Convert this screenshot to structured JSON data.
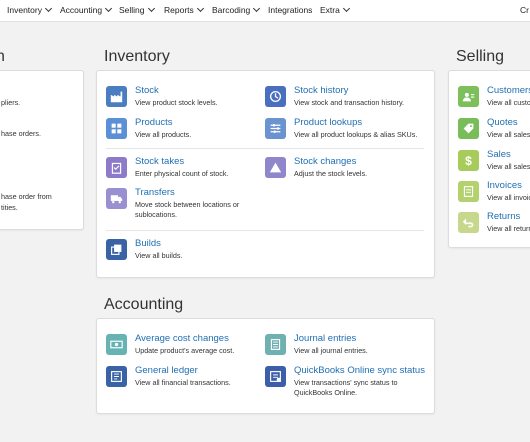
{
  "nav": {
    "items": [
      "Inventory",
      "Accounting",
      "Selling",
      "Reports",
      "Barcoding",
      "Integrations",
      "Extra"
    ],
    "right": "Cr"
  },
  "left_partial": {
    "title_frag": "n",
    "lines": [
      "pliers.",
      "hase orders.",
      "hase order from",
      "tities."
    ]
  },
  "inventory": {
    "title": "Inventory",
    "tiles": [
      {
        "title": "Stock",
        "desc": "View product stock levels.",
        "icon": "warehouse-icon"
      },
      {
        "title": "Stock history",
        "desc": "View stock and transaction history.",
        "icon": "history-icon"
      },
      {
        "title": "Products",
        "desc": "View all products.",
        "icon": "grid-icon"
      },
      {
        "title": "Product lookups",
        "desc": "View all product lookups & alias SKUs.",
        "icon": "sliders-icon"
      },
      {
        "title": "Stock takes",
        "desc": "Enter physical count of stock.",
        "icon": "clipboard-icon"
      },
      {
        "title": "Stock changes",
        "desc": "Adjust the stock levels.",
        "icon": "triangle-icon"
      },
      {
        "title": "Transfers",
        "desc": "Move stock between locations or sublocations.",
        "icon": "truck-icon"
      },
      {
        "title": "Builds",
        "desc": "View all builds.",
        "icon": "layers-icon"
      }
    ]
  },
  "accounting": {
    "title": "Accounting",
    "tiles": [
      {
        "title": "Average cost changes",
        "desc": "Update product's average cost.",
        "icon": "money-icon"
      },
      {
        "title": "Journal entries",
        "desc": "View all journal entries.",
        "icon": "journal-icon"
      },
      {
        "title": "General ledger",
        "desc": "View all financial transactions.",
        "icon": "ledger-icon"
      },
      {
        "title": "QuickBooks Online sync status",
        "desc": "View transactions' sync status to QuickBooks Online.",
        "icon": "sync-icon"
      }
    ]
  },
  "selling": {
    "title": "Selling",
    "tiles": [
      {
        "title": "Customers",
        "desc": "View all custo",
        "icon": "customers-icon"
      },
      {
        "title": "Quotes",
        "desc": "View all sales",
        "icon": "tag-icon"
      },
      {
        "title": "Sales",
        "desc": "View all sales",
        "icon": "dollar-icon"
      },
      {
        "title": "Invoices",
        "desc": "View all invoic",
        "icon": "invoice-icon"
      },
      {
        "title": "Returns",
        "desc": "View all return",
        "icon": "return-icon"
      }
    ]
  }
}
